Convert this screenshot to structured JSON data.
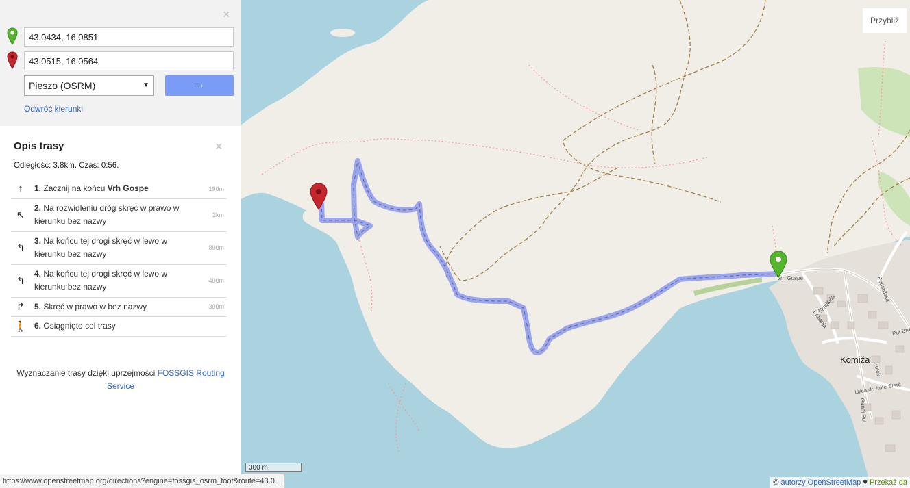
{
  "form": {
    "from_value": "43.0434, 16.0851",
    "to_value": "43.0515, 16.0564",
    "engine_selected": "Pieszo (OSRM)",
    "go_label": "→",
    "reverse_label": "Odwróć kierunki",
    "close_label": "×"
  },
  "route": {
    "title": "Opis trasy",
    "close_label": "×",
    "summary": "Odległość: 3.8km. Czas: 0:56.",
    "steps": [
      {
        "icon": "↑",
        "num": "1.",
        "text": "Zacznij na końcu ",
        "bold": "Vrh Gospe",
        "dist": "190m"
      },
      {
        "icon": "↖",
        "num": "2.",
        "text": "Na rozwidleniu dróg skręć w prawo w kierunku bez nazwy",
        "bold": "",
        "dist": "2km"
      },
      {
        "icon": "↰",
        "num": "3.",
        "text": "Na końcu tej drogi skręć w lewo w kierunku bez nazwy",
        "bold": "",
        "dist": "800m"
      },
      {
        "icon": "↰",
        "num": "4.",
        "text": "Na końcu tej drogi skręć w lewo w kierunku bez nazwy",
        "bold": "",
        "dist": "400m"
      },
      {
        "icon": "↱",
        "num": "5.",
        "text": "Skręć w prawo w bez nazwy",
        "bold": "",
        "dist": "300m"
      },
      {
        "icon": "🚶",
        "num": "6.",
        "text": "Osiągnięto cel trasy",
        "bold": "",
        "dist": ""
      }
    ],
    "attribution_prefix": "Wyznaczanie trasy dzięki uprzejmości ",
    "attribution_link": "FOSSGIS Routing Service"
  },
  "map": {
    "zoom_label": "Przybliż",
    "scale": "300 m",
    "town_label": "Komiža",
    "street_labels": [
      "Vrh Gospe",
      "Podspilska",
      "Pribanja",
      "Škrajšića",
      "Put Brd",
      "Potok",
      "Ulica dr. Ante Starč",
      "Gurinj Put"
    ],
    "attribution_prefix": "© ",
    "attribution_osm": "autorzy OpenStreetMap",
    "attribution_heart": " ♥ ",
    "attribution_green": "Przekaż da"
  },
  "status_url": "https://www.openstreetmap.org/directions?engine=fossgis_osrm_foot&route=43.0...",
  "colors": {
    "route_line": "#8f9cf0",
    "land": "#f1eee8",
    "water": "#aad3df",
    "pin_start": "#54b52c",
    "pin_end": "#c6262e",
    "button": "#7b9cf6"
  },
  "icons": [
    "green-marker-icon",
    "red-marker-icon",
    "close-icon"
  ]
}
